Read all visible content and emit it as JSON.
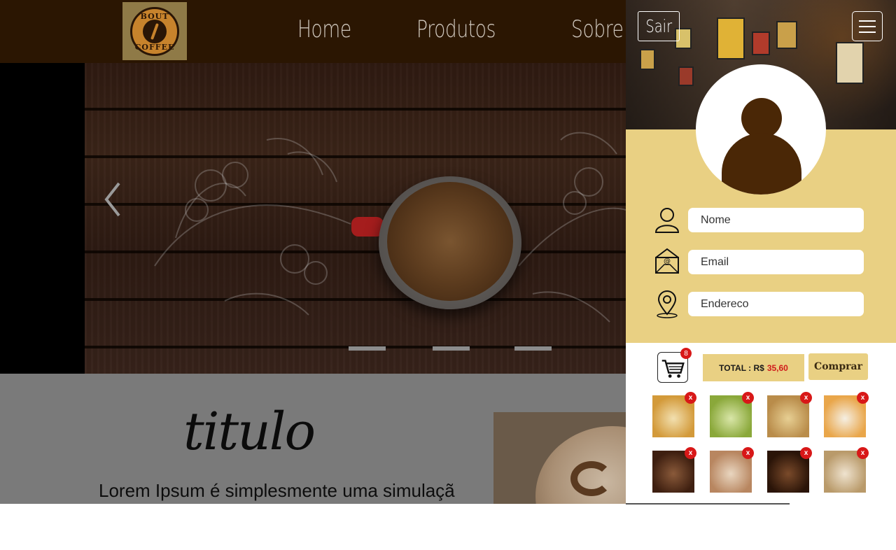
{
  "header": {
    "logo_top": "BOUT",
    "logo_bottom": "COFFEE",
    "nav": [
      {
        "label": "Home"
      },
      {
        "label": "Produtos"
      },
      {
        "label": "Sobre"
      }
    ]
  },
  "hero": {
    "slides_count": 3,
    "prev_icon": "chevron-left-icon"
  },
  "content": {
    "title": "titulo",
    "text": "Lorem Ipsum é simplesmente uma simulaçã"
  },
  "drawer": {
    "logout_label": "Sair",
    "menu_icon": "hamburger-menu-icon",
    "form": {
      "name_placeholder": "Nome",
      "email_placeholder": "Email",
      "address_placeholder": "Endereco"
    },
    "cart": {
      "count": "8",
      "total_label": "TOTAL : R$",
      "total_value": "35,60",
      "buy_label": "Comprar",
      "remove_label": "x",
      "items": [
        {
          "name": "cha-camomila",
          "colors": [
            "#d39a3a",
            "#f2e0b0"
          ]
        },
        {
          "name": "cha-verde",
          "colors": [
            "#8aa83a",
            "#d9e6a8"
          ]
        },
        {
          "name": "crepe",
          "colors": [
            "#b98c4a",
            "#e7cf93"
          ]
        },
        {
          "name": "donut",
          "colors": [
            "#e9a64a",
            "#f5efe3"
          ]
        },
        {
          "name": "brownie",
          "colors": [
            "#3e1f10",
            "#8a5a3a"
          ]
        },
        {
          "name": "cappuccino",
          "colors": [
            "#b88660",
            "#e9d6c0"
          ]
        },
        {
          "name": "frappuccino-chocolate",
          "colors": [
            "#2a1408",
            "#7a4a2a"
          ]
        },
        {
          "name": "frappuccino-caramelo",
          "colors": [
            "#b99a6a",
            "#efe3cf"
          ]
        }
      ]
    }
  },
  "colors": {
    "topbar": "#2b1602",
    "panel": "#e9d083",
    "accent_red": "#d81818",
    "avatar_brown": "#4a2706"
  }
}
